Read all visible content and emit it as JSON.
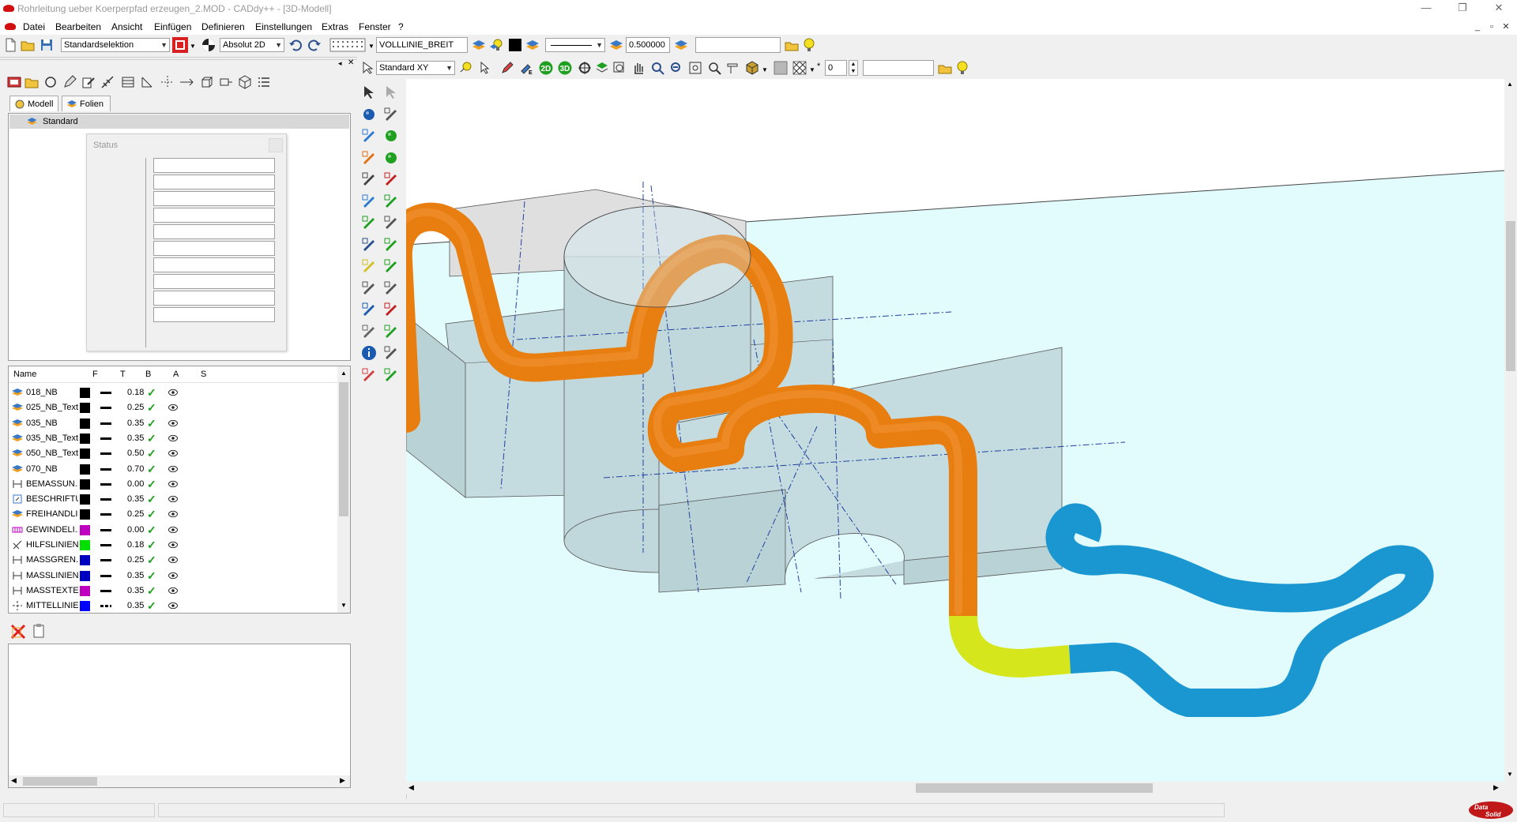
{
  "window": {
    "title": "Rohrleitung ueber Koerperpfad erzeugen_2.MOD  -  CADdy++ - [3D-Modell]",
    "min_symbol": "—",
    "restore_symbol": "❐",
    "close_symbol": "✕"
  },
  "menu": {
    "items": [
      "Datei",
      "Bearbeiten",
      "Ansicht",
      "Einfügen",
      "Definieren",
      "Einstellungen",
      "Extras",
      "Fenster",
      "?"
    ],
    "mdi_min": "_",
    "mdi_restore": "▫",
    "mdi_close": "✕"
  },
  "toolbar1": {
    "selection_mode": "Standardselektion",
    "coord_mode": "Absolut 2D",
    "line_type": "VOLLLINIE_BREIT",
    "line_width": "0.500000",
    "search_value": ""
  },
  "toolbar2": {
    "view_name": "Standard XY",
    "btn_2d": "2D",
    "btn_3d": "3D",
    "layer_number": "0",
    "search_value": ""
  },
  "left_panel": {
    "tabs": [
      "Modell",
      "Folien"
    ],
    "tree_root": "Standard",
    "status_dialog_title": "Status",
    "layer_columns": [
      "Name",
      "F",
      "T",
      "B",
      "A",
      "S"
    ],
    "layers": [
      {
        "name": "018_NB",
        "color": "#000000",
        "width": "0.18",
        "icon": "layer-icon"
      },
      {
        "name": "025_NB_Text",
        "color": "#000000",
        "width": "0.25",
        "icon": "layer-icon"
      },
      {
        "name": "035_NB",
        "color": "#000000",
        "width": "0.35",
        "icon": "layer-icon"
      },
      {
        "name": "035_NB_Text",
        "color": "#000000",
        "width": "0.35",
        "icon": "layer-icon"
      },
      {
        "name": "050_NB_Text",
        "color": "#000000",
        "width": "0.50",
        "icon": "layer-icon"
      },
      {
        "name": "070_NB",
        "color": "#000000",
        "width": "0.70",
        "icon": "layer-icon"
      },
      {
        "name": "BEMASSUN...",
        "color": "#000000",
        "width": "0.00",
        "icon": "dimension-icon"
      },
      {
        "name": "BESCHRIFTU...",
        "color": "#000000",
        "width": "0.35",
        "icon": "text-icon"
      },
      {
        "name": "FREIHANDLI...",
        "color": "#000000",
        "width": "0.25",
        "icon": "layer-icon"
      },
      {
        "name": "GEWINDELI...",
        "color": "#c000c0",
        "width": "0.00",
        "icon": "thread-icon"
      },
      {
        "name": "HILFSLINIEN",
        "color": "#00e000",
        "width": "0.18",
        "icon": "helpline-icon"
      },
      {
        "name": "MASSGREN...",
        "color": "#0000c0",
        "width": "0.25",
        "icon": "dimension-icon"
      },
      {
        "name": "MASSLINIEN",
        "color": "#0000c0",
        "width": "0.35",
        "icon": "dimension-icon"
      },
      {
        "name": "MASSTEXTE",
        "color": "#c000c0",
        "width": "0.35",
        "icon": "dimension-icon"
      },
      {
        "name": "MITTELLINIEN",
        "color": "#0000ff",
        "width": "0.35",
        "icon": "centerline-icon"
      }
    ]
  },
  "colors": {
    "viewport_bg": "#e2fbfc",
    "pipe_orange": "#e87d10",
    "pipe_yellow": "#d6e61c",
    "pipe_blue": "#1a96d0",
    "solid_fill": "#c4dcdf"
  },
  "brand": {
    "logo_text": "Data Solid"
  }
}
